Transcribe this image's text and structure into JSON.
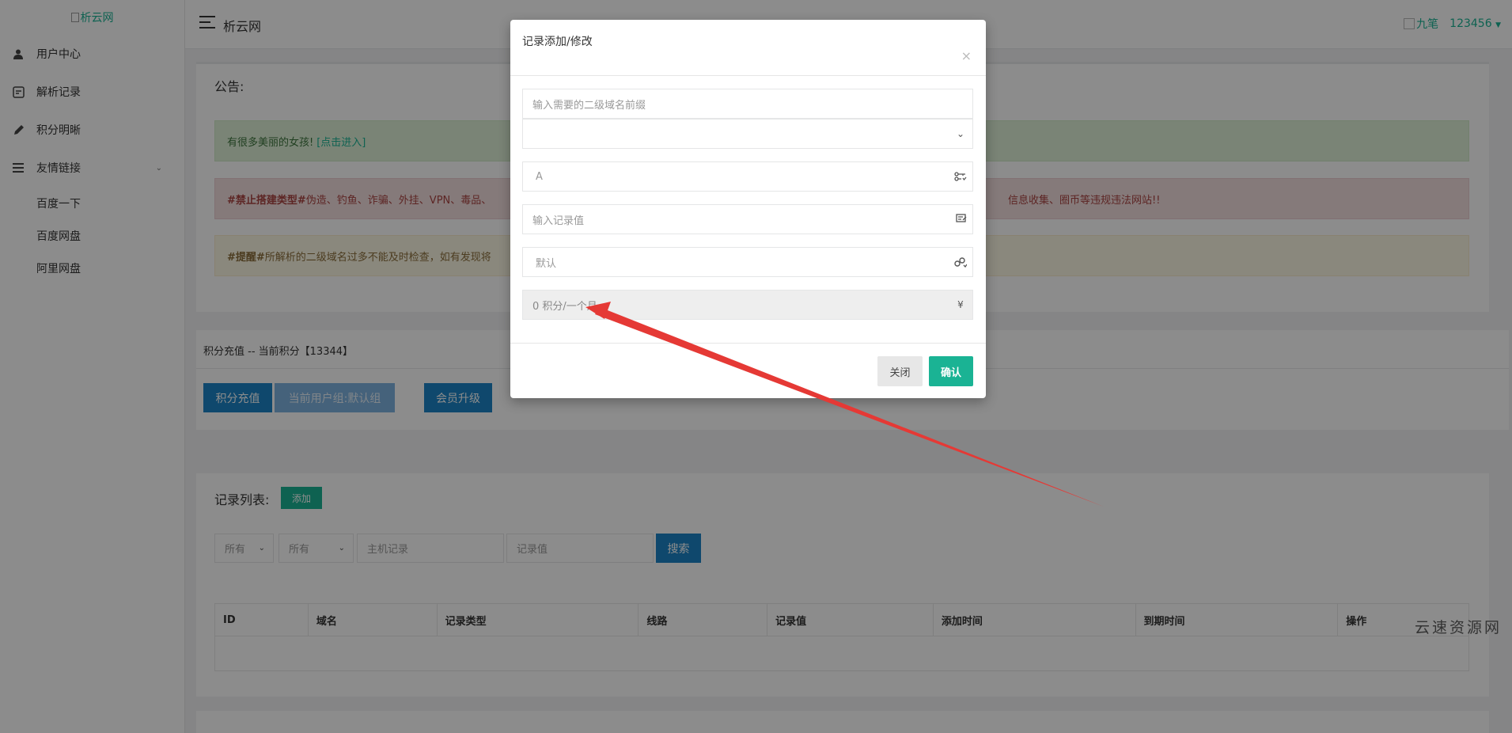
{
  "sidebar": {
    "logo_alt": "析云网",
    "items": [
      {
        "label": "用户中心",
        "icon": "user-icon"
      },
      {
        "label": "解析记录",
        "icon": "record-icon"
      },
      {
        "label": "积分明晰",
        "icon": "pencil-icon"
      },
      {
        "label": "友情链接",
        "icon": "bars-icon"
      }
    ],
    "sub_items": [
      "百度一下",
      "百度网盘",
      "阿里网盘"
    ]
  },
  "topbar": {
    "brand": "析云网",
    "user_name": "九笔",
    "user_id": "123456"
  },
  "notice": {
    "title": "公告:",
    "success_text": "有很多美丽的女孩!",
    "success_link": "[点击进入]",
    "danger_tag": "#禁止搭建类型#",
    "danger_text_left": " 伪造、钓鱼、诈骗、外挂、VPN、毒品、",
    "danger_text_right": "信息收集、圈币等违规违法网站!!",
    "warning_tag": "#提醒#",
    "warning_text": " 所解析的二级域名过多不能及时检查，如有发现将"
  },
  "points": {
    "title": "积分充值 -- 当前积分【13344】",
    "recharge_label": "积分充值",
    "group_label": "当前用户组:默认组",
    "upgrade_label": "会员升级"
  },
  "records": {
    "title": "记录列表:",
    "add_label": "添加",
    "filter_all_1": "所有",
    "filter_all_2": "所有",
    "host_placeholder": "主机记录",
    "value_placeholder": "记录值",
    "search_label": "搜索",
    "columns": [
      "ID",
      "域名",
      "记录类型",
      "线路",
      "记录值",
      "添加时间",
      "到期时间",
      "操作"
    ]
  },
  "modal": {
    "title": "记录添加/修改",
    "close_symbol": "×",
    "prefix_placeholder": "输入需要的二级域名前缀",
    "type_value": "A",
    "value_placeholder": "输入记录值",
    "line_value": "默认",
    "cost_value": "0 积分/一个月",
    "currency_symbol": "¥",
    "close_label": "关闭",
    "confirm_label": "确认"
  },
  "watermark": "云速资源网",
  "colors": {
    "accent_green": "#1ab394",
    "primary_blue": "#1c84c6",
    "annotation_arrow": "#e53935"
  }
}
